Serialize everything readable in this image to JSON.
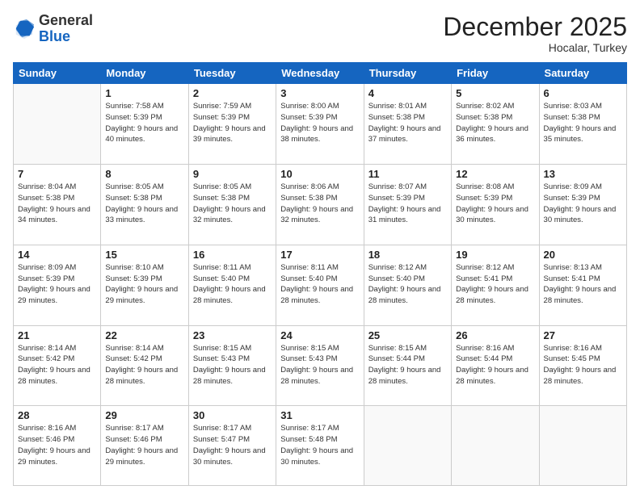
{
  "header": {
    "logo_general": "General",
    "logo_blue": "Blue",
    "month_title": "December 2025",
    "location": "Hocalar, Turkey"
  },
  "days_of_week": [
    "Sunday",
    "Monday",
    "Tuesday",
    "Wednesday",
    "Thursday",
    "Friday",
    "Saturday"
  ],
  "weeks": [
    [
      {
        "day": "",
        "sunrise": "",
        "sunset": "",
        "daylight": ""
      },
      {
        "day": "1",
        "sunrise": "Sunrise: 7:58 AM",
        "sunset": "Sunset: 5:39 PM",
        "daylight": "Daylight: 9 hours and 40 minutes."
      },
      {
        "day": "2",
        "sunrise": "Sunrise: 7:59 AM",
        "sunset": "Sunset: 5:39 PM",
        "daylight": "Daylight: 9 hours and 39 minutes."
      },
      {
        "day": "3",
        "sunrise": "Sunrise: 8:00 AM",
        "sunset": "Sunset: 5:39 PM",
        "daylight": "Daylight: 9 hours and 38 minutes."
      },
      {
        "day": "4",
        "sunrise": "Sunrise: 8:01 AM",
        "sunset": "Sunset: 5:38 PM",
        "daylight": "Daylight: 9 hours and 37 minutes."
      },
      {
        "day": "5",
        "sunrise": "Sunrise: 8:02 AM",
        "sunset": "Sunset: 5:38 PM",
        "daylight": "Daylight: 9 hours and 36 minutes."
      },
      {
        "day": "6",
        "sunrise": "Sunrise: 8:03 AM",
        "sunset": "Sunset: 5:38 PM",
        "daylight": "Daylight: 9 hours and 35 minutes."
      }
    ],
    [
      {
        "day": "7",
        "sunrise": "Sunrise: 8:04 AM",
        "sunset": "Sunset: 5:38 PM",
        "daylight": "Daylight: 9 hours and 34 minutes."
      },
      {
        "day": "8",
        "sunrise": "Sunrise: 8:05 AM",
        "sunset": "Sunset: 5:38 PM",
        "daylight": "Daylight: 9 hours and 33 minutes."
      },
      {
        "day": "9",
        "sunrise": "Sunrise: 8:05 AM",
        "sunset": "Sunset: 5:38 PM",
        "daylight": "Daylight: 9 hours and 32 minutes."
      },
      {
        "day": "10",
        "sunrise": "Sunrise: 8:06 AM",
        "sunset": "Sunset: 5:38 PM",
        "daylight": "Daylight: 9 hours and 32 minutes."
      },
      {
        "day": "11",
        "sunrise": "Sunrise: 8:07 AM",
        "sunset": "Sunset: 5:39 PM",
        "daylight": "Daylight: 9 hours and 31 minutes."
      },
      {
        "day": "12",
        "sunrise": "Sunrise: 8:08 AM",
        "sunset": "Sunset: 5:39 PM",
        "daylight": "Daylight: 9 hours and 30 minutes."
      },
      {
        "day": "13",
        "sunrise": "Sunrise: 8:09 AM",
        "sunset": "Sunset: 5:39 PM",
        "daylight": "Daylight: 9 hours and 30 minutes."
      }
    ],
    [
      {
        "day": "14",
        "sunrise": "Sunrise: 8:09 AM",
        "sunset": "Sunset: 5:39 PM",
        "daylight": "Daylight: 9 hours and 29 minutes."
      },
      {
        "day": "15",
        "sunrise": "Sunrise: 8:10 AM",
        "sunset": "Sunset: 5:39 PM",
        "daylight": "Daylight: 9 hours and 29 minutes."
      },
      {
        "day": "16",
        "sunrise": "Sunrise: 8:11 AM",
        "sunset": "Sunset: 5:40 PM",
        "daylight": "Daylight: 9 hours and 28 minutes."
      },
      {
        "day": "17",
        "sunrise": "Sunrise: 8:11 AM",
        "sunset": "Sunset: 5:40 PM",
        "daylight": "Daylight: 9 hours and 28 minutes."
      },
      {
        "day": "18",
        "sunrise": "Sunrise: 8:12 AM",
        "sunset": "Sunset: 5:40 PM",
        "daylight": "Daylight: 9 hours and 28 minutes."
      },
      {
        "day": "19",
        "sunrise": "Sunrise: 8:12 AM",
        "sunset": "Sunset: 5:41 PM",
        "daylight": "Daylight: 9 hours and 28 minutes."
      },
      {
        "day": "20",
        "sunrise": "Sunrise: 8:13 AM",
        "sunset": "Sunset: 5:41 PM",
        "daylight": "Daylight: 9 hours and 28 minutes."
      }
    ],
    [
      {
        "day": "21",
        "sunrise": "Sunrise: 8:14 AM",
        "sunset": "Sunset: 5:42 PM",
        "daylight": "Daylight: 9 hours and 28 minutes."
      },
      {
        "day": "22",
        "sunrise": "Sunrise: 8:14 AM",
        "sunset": "Sunset: 5:42 PM",
        "daylight": "Daylight: 9 hours and 28 minutes."
      },
      {
        "day": "23",
        "sunrise": "Sunrise: 8:15 AM",
        "sunset": "Sunset: 5:43 PM",
        "daylight": "Daylight: 9 hours and 28 minutes."
      },
      {
        "day": "24",
        "sunrise": "Sunrise: 8:15 AM",
        "sunset": "Sunset: 5:43 PM",
        "daylight": "Daylight: 9 hours and 28 minutes."
      },
      {
        "day": "25",
        "sunrise": "Sunrise: 8:15 AM",
        "sunset": "Sunset: 5:44 PM",
        "daylight": "Daylight: 9 hours and 28 minutes."
      },
      {
        "day": "26",
        "sunrise": "Sunrise: 8:16 AM",
        "sunset": "Sunset: 5:44 PM",
        "daylight": "Daylight: 9 hours and 28 minutes."
      },
      {
        "day": "27",
        "sunrise": "Sunrise: 8:16 AM",
        "sunset": "Sunset: 5:45 PM",
        "daylight": "Daylight: 9 hours and 28 minutes."
      }
    ],
    [
      {
        "day": "28",
        "sunrise": "Sunrise: 8:16 AM",
        "sunset": "Sunset: 5:46 PM",
        "daylight": "Daylight: 9 hours and 29 minutes."
      },
      {
        "day": "29",
        "sunrise": "Sunrise: 8:17 AM",
        "sunset": "Sunset: 5:46 PM",
        "daylight": "Daylight: 9 hours and 29 minutes."
      },
      {
        "day": "30",
        "sunrise": "Sunrise: 8:17 AM",
        "sunset": "Sunset: 5:47 PM",
        "daylight": "Daylight: 9 hours and 30 minutes."
      },
      {
        "day": "31",
        "sunrise": "Sunrise: 8:17 AM",
        "sunset": "Sunset: 5:48 PM",
        "daylight": "Daylight: 9 hours and 30 minutes."
      },
      {
        "day": "",
        "sunrise": "",
        "sunset": "",
        "daylight": ""
      },
      {
        "day": "",
        "sunrise": "",
        "sunset": "",
        "daylight": ""
      },
      {
        "day": "",
        "sunrise": "",
        "sunset": "",
        "daylight": ""
      }
    ]
  ]
}
